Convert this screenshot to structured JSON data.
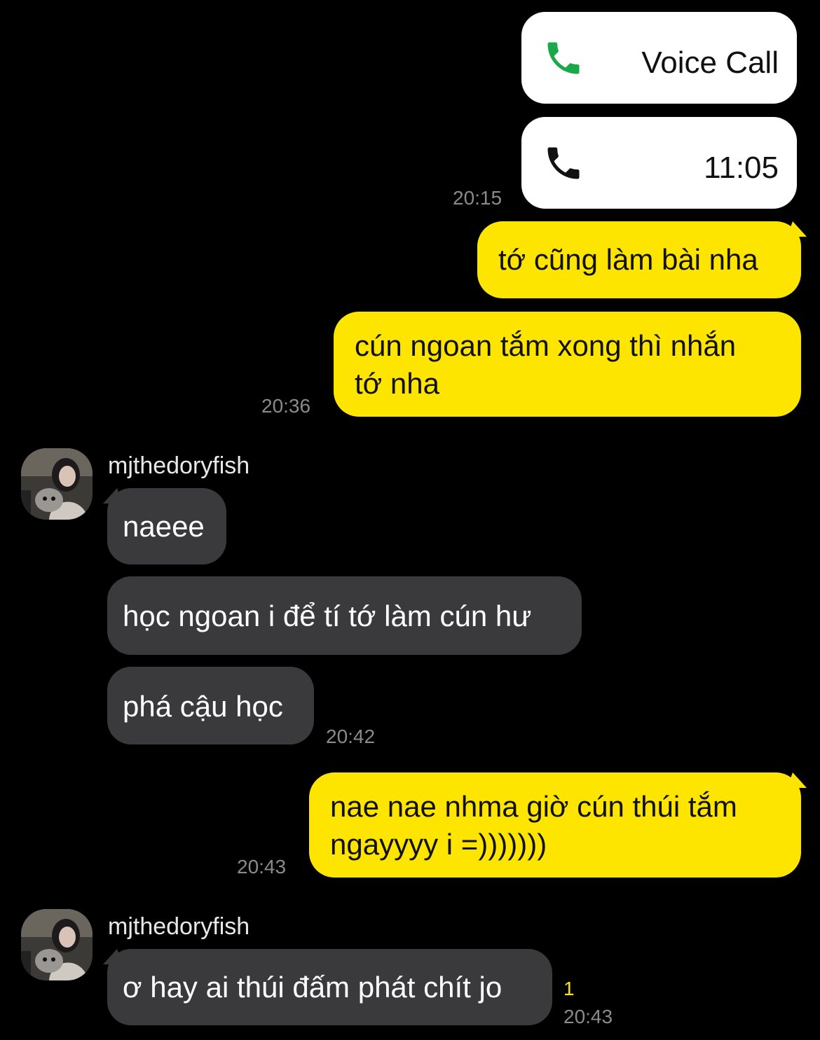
{
  "colors": {
    "background": "#000000",
    "outgoing_bubble": "#fee500",
    "incoming_bubble": "#3a3a3c",
    "call_card": "#ffffff",
    "call_green": "#1aa84a",
    "timestamp": "#8a8a8a",
    "unread": "#fee500"
  },
  "calls": [
    {
      "icon": "phone-green-icon",
      "label": "Voice Call"
    },
    {
      "icon": "phone-black-icon",
      "label": "11:05"
    }
  ],
  "call_time": "20:15",
  "messages": [
    {
      "direction": "out",
      "text": "tớ cũng làm bài nha"
    },
    {
      "direction": "out",
      "text_line1": "cún ngoan tắm xong thì nhắn",
      "text_line2": "tớ nha",
      "time": "20:36"
    },
    {
      "direction": "in",
      "sender": "mjthedoryfish",
      "bubbles": [
        "naeee",
        "học ngoan i để tí tớ làm cún hư",
        "phá cậu học"
      ],
      "time": "20:42"
    },
    {
      "direction": "out",
      "text_line1": "nae nae nhma giờ cún thúi tắm",
      "text_line2": "ngayyyy i =)))))))",
      "time": "20:43"
    },
    {
      "direction": "in",
      "sender": "mjthedoryfish",
      "bubbles": [
        "ơ hay ai thúi đấm phát chít jo"
      ],
      "unread": "1",
      "time": "20:43"
    }
  ]
}
